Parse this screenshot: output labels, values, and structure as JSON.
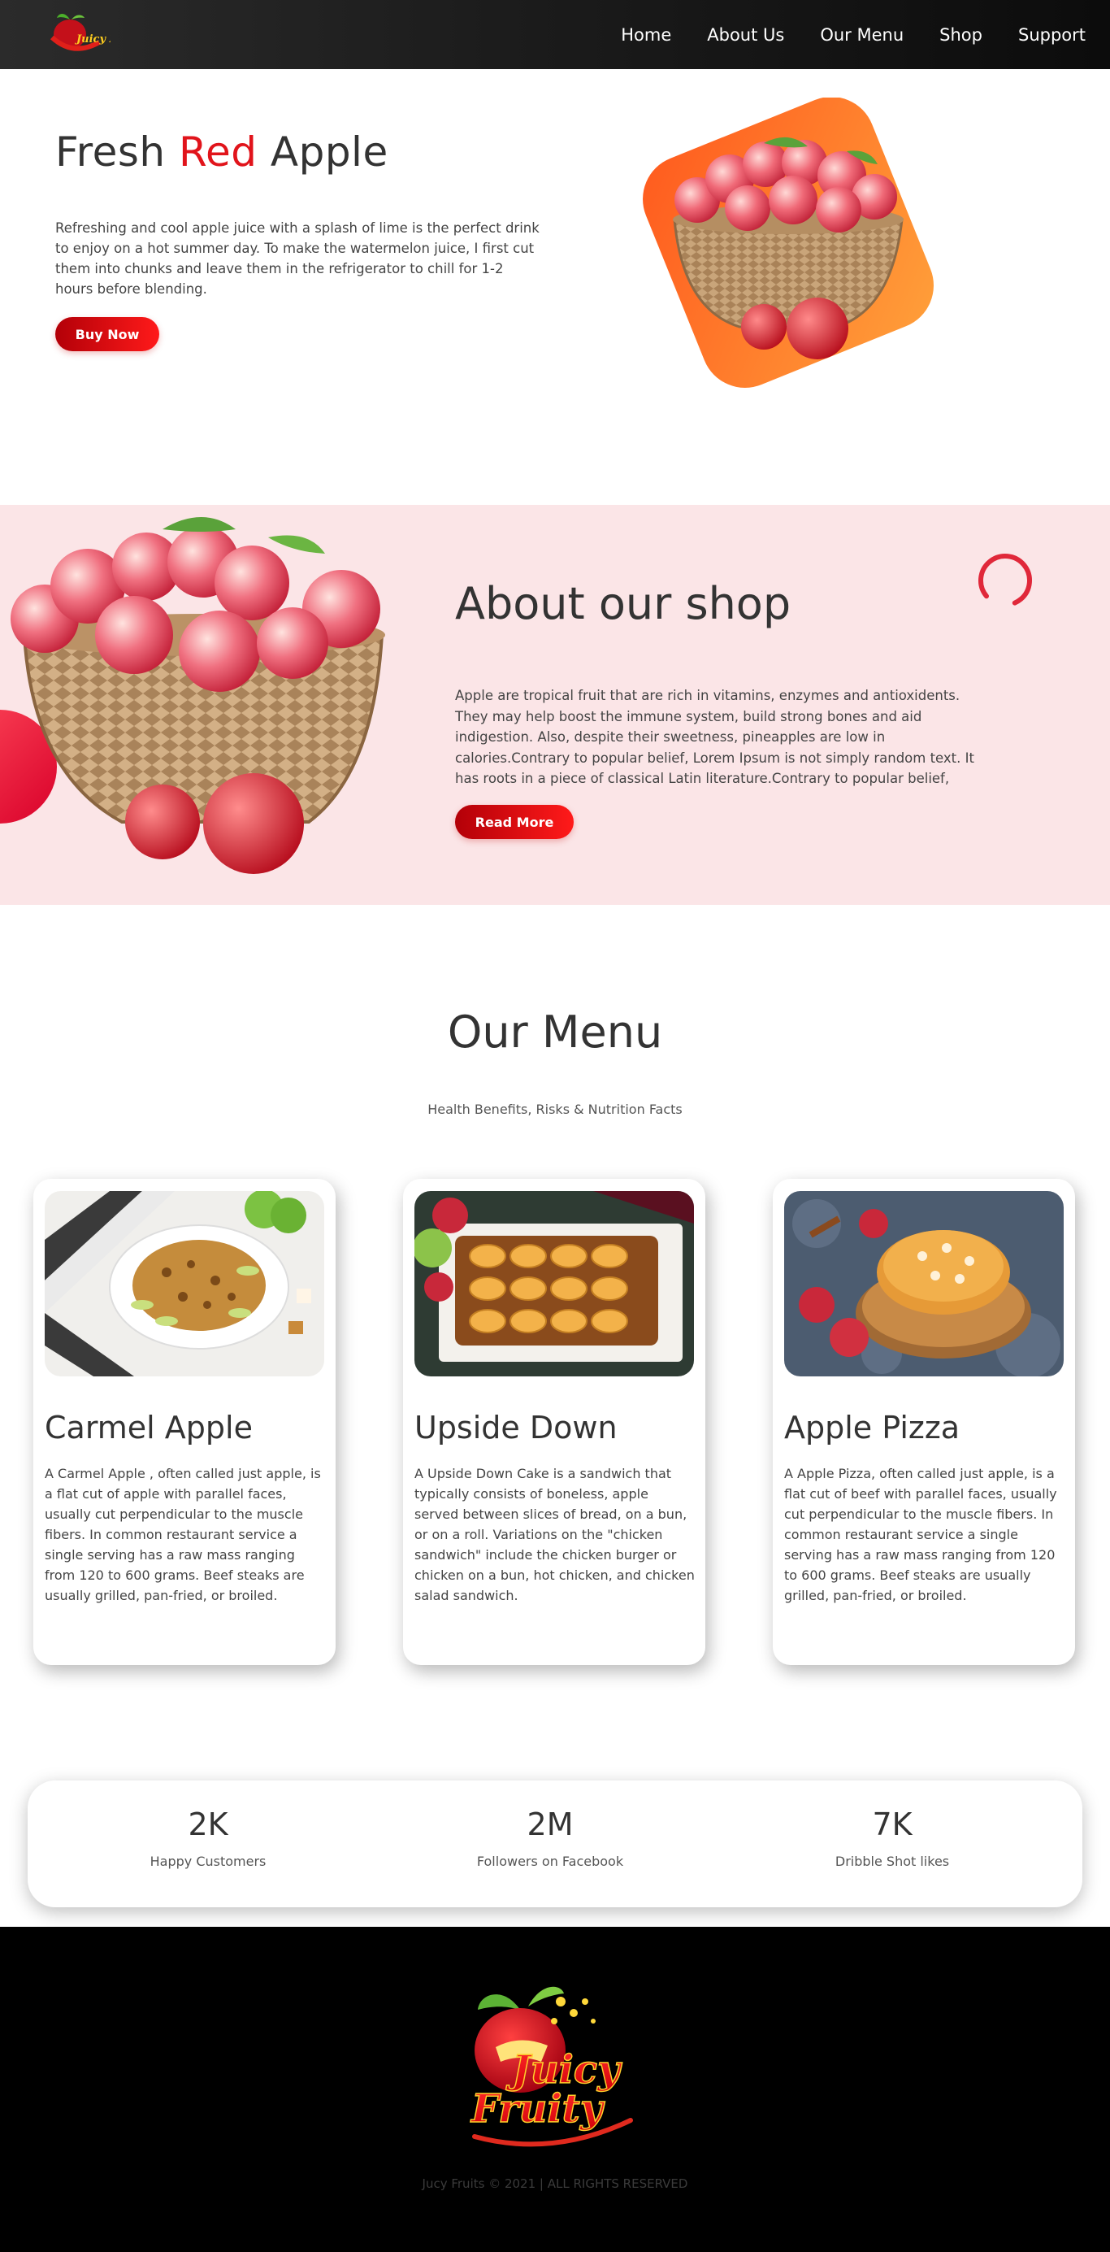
{
  "nav": {
    "logo_text": "Juicy Fruity",
    "links": [
      "Home",
      "About Us",
      "Our Menu",
      "Shop",
      "Support"
    ]
  },
  "hero": {
    "title_part1": "Fresh ",
    "title_accent": "Red",
    "title_part2": " Apple",
    "text": "Refreshing and cool apple juice with a splash of lime is the perfect drink to enjoy on a hot summer day. To make the watermelon juice, I first cut them into chunks and leave them in the refrigerator to chill for 1-2 hours before blending.",
    "button": "Buy Now"
  },
  "about": {
    "title": "About our shop",
    "text": "Apple are tropical fruit that are rich in vitamins, enzymes and antioxidents. They may help boost the immune system, build strong bones and aid indigestion. Also, despite their sweetness, pineapples are low in calories.Contrary to popular belief, Lorem Ipsum is not simply random text. It has roots in a piece of classical Latin literature.Contrary to popular belief,",
    "button": "Read More"
  },
  "menu": {
    "title": "Our Menu",
    "subtitle": "Health Benefits, Risks & Nutrition Facts",
    "cards": [
      {
        "title": "Carmel Apple",
        "text": "A Carmel Apple , often called just apple, is a flat cut of apple with parallel faces, usually cut perpendicular to the muscle fibers. In common restaurant service a single serving has a raw mass ranging from 120 to 600 grams. Beef steaks are usually grilled, pan-fried, or broiled."
      },
      {
        "title": "Upside Down",
        "text": "A Upside Down Cake is a sandwich that typically consists of boneless, apple served between slices of bread, on a bun, or on a roll. Variations on the \"chicken sandwich\" include the chicken burger or chicken on a bun, hot chicken, and chicken salad sandwich."
      },
      {
        "title": "Apple Pizza",
        "text": "A Apple Pizza, often called just apple, is a flat cut of beef with parallel faces, usually cut perpendicular to the muscle fibers. In common restaurant service a single serving has a raw mass ranging from 120 to 600 grams. Beef steaks are usually grilled, pan-fried, or broiled."
      }
    ]
  },
  "stats": [
    {
      "value": "2K",
      "label": "Happy Customers"
    },
    {
      "value": "2M",
      "label": "Followers on Facebook"
    },
    {
      "value": "7K",
      "label": "Dribble Shot likes"
    }
  ],
  "footer": {
    "logo_line1": "Juicy",
    "logo_line2": "Fruity",
    "copyright": "Jucy Fruits © 2021 | ALL RIGHTS RESERVED"
  },
  "colors": {
    "accent": "#e1141b",
    "about_bg": "#fbe5e7",
    "nav_bg": "#1c1c1c",
    "footer_bg": "#000000"
  }
}
